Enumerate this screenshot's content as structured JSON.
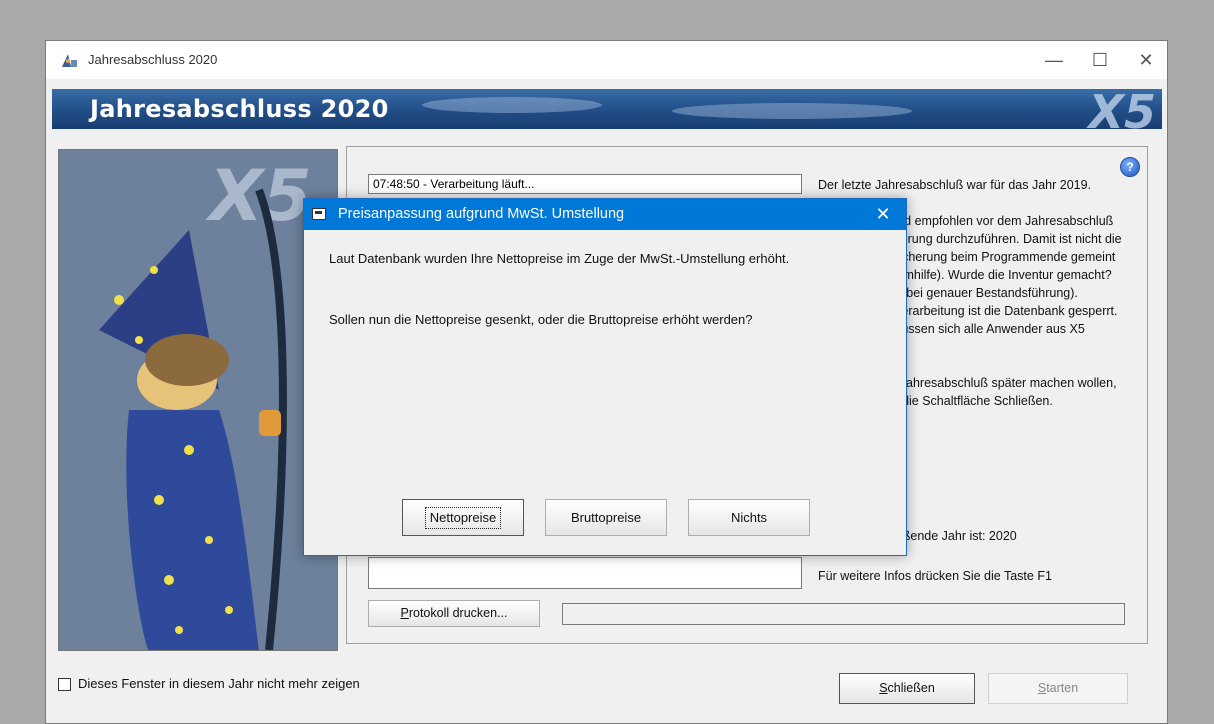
{
  "window": {
    "title": "Jahresabschluss 2020",
    "controls": {
      "minimize": "—",
      "maximize": "☐",
      "close": "✕"
    }
  },
  "banner": {
    "title": "Jahresabschluss 2020",
    "logo": "X5"
  },
  "log": {
    "line1": "07:48:50 - Verarbeitung läuft...",
    "line2": ""
  },
  "info": {
    "p1": "Der letzte Jahresabschluß war für das Jahr 2019.",
    "p2": "Es wird dringend empfohlen vor dem Jahresabschluß eine Datensicherung durchzuführen. Damit ist nicht die interne Datensicherung beim Programmende gemeint (siehe Programmhilfe). Wurde die Inventur gemacht? (Nur notwendig bei genauer Bestandsführung). Während der Verarbeitung ist die Datenbank gesperrt. Im Netzwerk müssen sich alle Anwender aus X5 abmelden.",
    "p3": "Wenn Sie den Jahresabschluß später machen wollen, klicken Sie auf die Schaltfläche Schließen.",
    "end_year": "Das abzuschließende Jahr ist: 2020",
    "f1_hint": "Für weitere Infos drücken Sie die Taste F1",
    "help_icon": "?"
  },
  "buttons": {
    "print_log": {
      "prefix": "",
      "accel": "P",
      "rest": "rotokoll drucken..."
    },
    "close": {
      "accel": "S",
      "rest": "chließen"
    },
    "start": {
      "accel": "S",
      "rest": "tarten"
    }
  },
  "checkbox": {
    "label": "Dieses Fenster in diesem Jahr nicht mehr zeigen",
    "checked": false
  },
  "dialog": {
    "title": "Preisanpassung aufgrund MwSt. Umstellung",
    "close": "✕",
    "message1": "Laut Datenbank wurden Ihre Nettopreise im Zuge der MwSt.-Umstellung erhöht.",
    "message2": "Sollen nun die Nettopreise gesenkt, oder die Bruttopreise erhöht werden?",
    "btn_netto": "Nettopreise",
    "btn_brutto": "Bruttopreise",
    "btn_nichts": "Nichts"
  },
  "colors": {
    "dialog_titlebar": "#0078d7",
    "banner": "#24528c"
  }
}
